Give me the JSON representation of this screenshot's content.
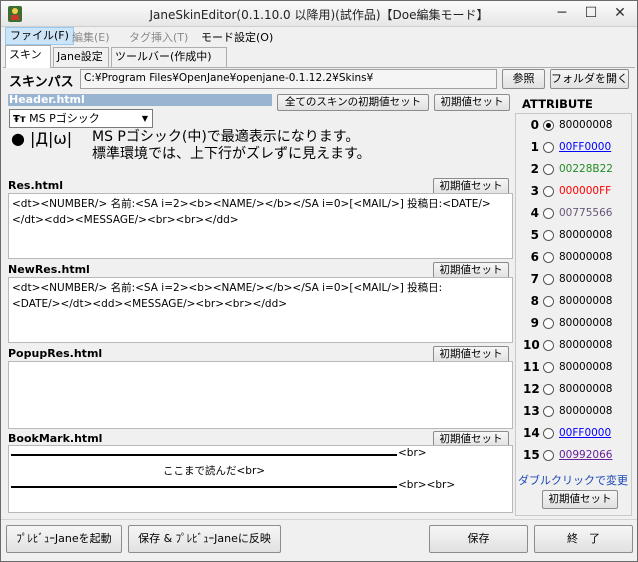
{
  "window": {
    "title": "JaneSkinEditor(0.1.10.0 以降用)(試作品)【Doe編集モード】",
    "minimize_glyph": "─",
    "maximize_glyph": "☐",
    "close_glyph": "✕"
  },
  "menu": {
    "file": "ファイル(F)",
    "edit": "編集(E)",
    "tag_insert": "タグ挿入(T)",
    "mode_settings": "モード設定(O)"
  },
  "tabs": [
    "スキン",
    "Jane設定",
    "ツールバー(作成中)"
  ],
  "skin_path": {
    "label": "スキンパス",
    "value": "C:¥Program Files¥OpenJane¥openjane-0.1.12.2¥Skins¥",
    "browse_label": "参照",
    "open_folder_label": "フォルダを開く"
  },
  "header": {
    "label": "Header.html",
    "all_reset_label": "全てのスキンの初期値セット",
    "reset_label": "初期値セット",
    "font_name": "MS Pゴシック",
    "font_tt": "Ŧт",
    "preview_glyphs": "●   |Д|ω|",
    "preview_line1": "MS Pゴシック(中)で最適表示になります。",
    "preview_line2": "標準環境では、上下行がズレずに見えます。"
  },
  "sections": {
    "res": {
      "label": "Res.html",
      "reset_label": "初期値セット",
      "content": "<dt><NUMBER/> 名前:<SA i=2><b><NAME/></b></SA i=0>[<MAIL/>] 投稿日:<DATE/>\n</dt><dd><MESSAGE/><br><br></dd>"
    },
    "newres": {
      "label": "NewRes.html",
      "reset_label": "初期値セット",
      "content": "<dt><NUMBER/> 名前:<SA i=2><b><NAME/></b></SA i=0>[<MAIL/>] 投稿日:\n<DATE/></dt><dd><MESSAGE/><br><br></dd>"
    },
    "popupres": {
      "label": "PopupRes.html",
      "reset_label": "初期値セット",
      "content": ""
    },
    "bookmark": {
      "label": "BookMark.html",
      "reset_label": "初期値セット",
      "br1": "<br>",
      "middle": "ここまで読んだ<br>",
      "br2": "<br><br>"
    }
  },
  "attribute": {
    "title": "ATTRIBUTE",
    "items": [
      {
        "num": "0",
        "value": "80000008",
        "color": "#000000",
        "underline": false
      },
      {
        "num": "1",
        "value": "00FF0000",
        "color": "#0000ff",
        "underline": true
      },
      {
        "num": "2",
        "value": "00228B22",
        "color": "#228b22",
        "underline": false
      },
      {
        "num": "3",
        "value": "000000FF",
        "color": "#ff0000",
        "underline": false
      },
      {
        "num": "4",
        "value": "00775566",
        "color": "#665577",
        "underline": false
      },
      {
        "num": "5",
        "value": "80000008",
        "color": "#000000",
        "underline": false
      },
      {
        "num": "6",
        "value": "80000008",
        "color": "#000000",
        "underline": false
      },
      {
        "num": "7",
        "value": "80000008",
        "color": "#000000",
        "underline": false
      },
      {
        "num": "8",
        "value": "80000008",
        "color": "#000000",
        "underline": false
      },
      {
        "num": "9",
        "value": "80000008",
        "color": "#000000",
        "underline": false
      },
      {
        "num": "10",
        "value": "80000008",
        "color": "#000000",
        "underline": false
      },
      {
        "num": "11",
        "value": "80000008",
        "color": "#000000",
        "underline": false
      },
      {
        "num": "12",
        "value": "80000008",
        "color": "#000000",
        "underline": false
      },
      {
        "num": "13",
        "value": "80000008",
        "color": "#000000",
        "underline": false
      },
      {
        "num": "14",
        "value": "00FF0000",
        "color": "#0000ff",
        "underline": true
      },
      {
        "num": "15",
        "value": "00992066",
        "color": "#662099",
        "underline": true
      }
    ],
    "selected_index": 0,
    "dblclick_hint": "ダブルクリックで変更",
    "reset_label": "初期値セット"
  },
  "footer": {
    "preview_launch": "ﾌﾟﾚﾋﾞｭｰJaneを起動",
    "save_and_preview": "保存 & ﾌﾟﾚﾋﾞｭｰJaneに反映",
    "save": "保存",
    "exit": "終　了"
  }
}
